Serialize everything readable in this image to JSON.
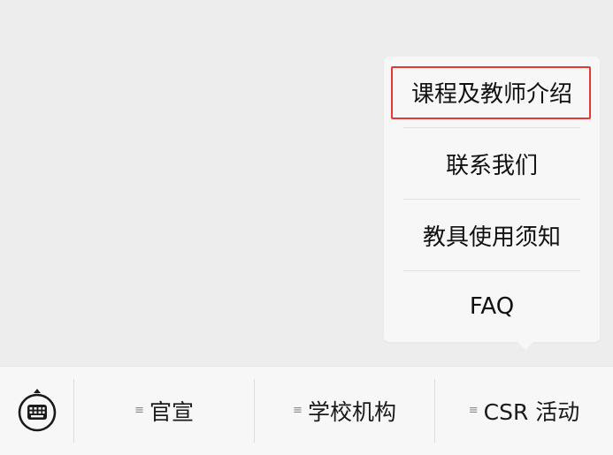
{
  "popup_menu": {
    "items": [
      {
        "label": "课程及教师介绍",
        "highlighted": true
      },
      {
        "label": "联系我们"
      },
      {
        "label": "教具使用须知"
      },
      {
        "label": "FAQ"
      }
    ]
  },
  "bottom_bar": {
    "keyboard_icon": "keyboard-icon",
    "tabs": [
      {
        "label": "官宣",
        "icon": "menu-lines-icon"
      },
      {
        "label": "学校机构",
        "icon": "menu-lines-icon"
      },
      {
        "label": "CSR 活动",
        "icon": "menu-lines-icon"
      }
    ]
  },
  "colors": {
    "background": "#ededed",
    "panel": "#f7f7f7",
    "highlight_border": "#e53935"
  }
}
